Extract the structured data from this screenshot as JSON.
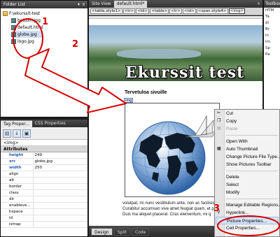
{
  "folder_list": {
    "title": "Folder List",
    "root": "F:\\ekurssit-test",
    "items": [
      {
        "label": "bottom.jpg",
        "selected": false
      },
      {
        "label": "default.html",
        "selected": false
      },
      {
        "label": "globe.jpg",
        "selected": true
      },
      {
        "label": "logo.jpg",
        "selected": false
      }
    ]
  },
  "tag_panel": {
    "tabs": [
      "Tag Proper...",
      "CSS Properties"
    ],
    "tag": "<img>",
    "attributes_header": "Attributes",
    "attributes": [
      {
        "name": "height",
        "value": "249",
        "set": true
      },
      {
        "name": "src",
        "value": "globe.jpg",
        "set": true
      },
      {
        "name": "width",
        "value": "250",
        "set": true
      },
      {
        "name": "align",
        "value": "",
        "set": false
      },
      {
        "name": "alt",
        "value": "",
        "set": false
      },
      {
        "name": "border",
        "value": "",
        "set": false
      },
      {
        "name": "class",
        "value": "",
        "set": false
      },
      {
        "name": "dir",
        "value": "",
        "set": false
      },
      {
        "name": "enableve...",
        "value": "",
        "set": false
      },
      {
        "name": "hspace",
        "value": "",
        "set": false
      },
      {
        "name": "id",
        "value": "",
        "set": false
      },
      {
        "name": "ismap",
        "value": "",
        "set": false
      }
    ]
  },
  "document": {
    "tabs": [
      "Site View",
      "default.html*"
    ],
    "close_glyph": "×",
    "crumbs": [
      "<table.style1>",
      "<tr>",
      "<td>",
      "<table>",
      "<tr>",
      "<td>",
      "<span.style4>",
      "<img>"
    ],
    "banner_title": "Ekurssit test",
    "welcome": "Tervetuloa sivuille",
    "img_tag": "img",
    "body_text": "volutpat, mi nunc vestibulum ante, non ac facilisis lacus. Curabitur accumsan vive amet feugiat quam, et pede. Duis ma aliquet placerat. Cras elementum, mi q",
    "view_buttons": [
      "Design",
      "Split",
      "Code"
    ]
  },
  "toolbox": {
    "title": "Toolbox",
    "items": [
      "HTM",
      "Ta",
      "di",
      "Br",
      "In",
      "Im",
      "Sp",
      "Pa"
    ]
  },
  "context_menu": {
    "items": [
      {
        "label": "Cut",
        "icon": "cut-icon",
        "disabled": false
      },
      {
        "label": "Copy",
        "icon": "copy-icon",
        "disabled": false
      },
      {
        "label": "Paste",
        "icon": "paste-icon",
        "disabled": true
      },
      {
        "sep": true
      },
      {
        "label": "Open With",
        "icon": "",
        "disabled": false
      },
      {
        "label": "Auto Thumbnail",
        "icon": "thumbnail-icon",
        "disabled": false
      },
      {
        "label": "Change Picture File Type...",
        "icon": "",
        "disabled": false
      },
      {
        "label": "Show Pictures Toolbar",
        "icon": "",
        "disabled": false
      },
      {
        "sep": true
      },
      {
        "label": "Delete",
        "icon": "",
        "disabled": false
      },
      {
        "label": "Select",
        "icon": "",
        "disabled": false
      },
      {
        "label": "Modify",
        "icon": "",
        "disabled": false
      },
      {
        "sep": true
      },
      {
        "label": "Manage Editable Regions...",
        "icon": "",
        "disabled": false
      },
      {
        "label": "Hyperlink...",
        "icon": "hyperlink-icon",
        "disabled": false
      },
      {
        "label": "Picture Properties...",
        "icon": "",
        "disabled": false,
        "highlighted": true
      },
      {
        "label": "Cell Properties...",
        "icon": "",
        "disabled": false
      }
    ]
  },
  "annotations": {
    "numbers": [
      "1",
      "2",
      "3"
    ],
    "color": "#d40000"
  }
}
